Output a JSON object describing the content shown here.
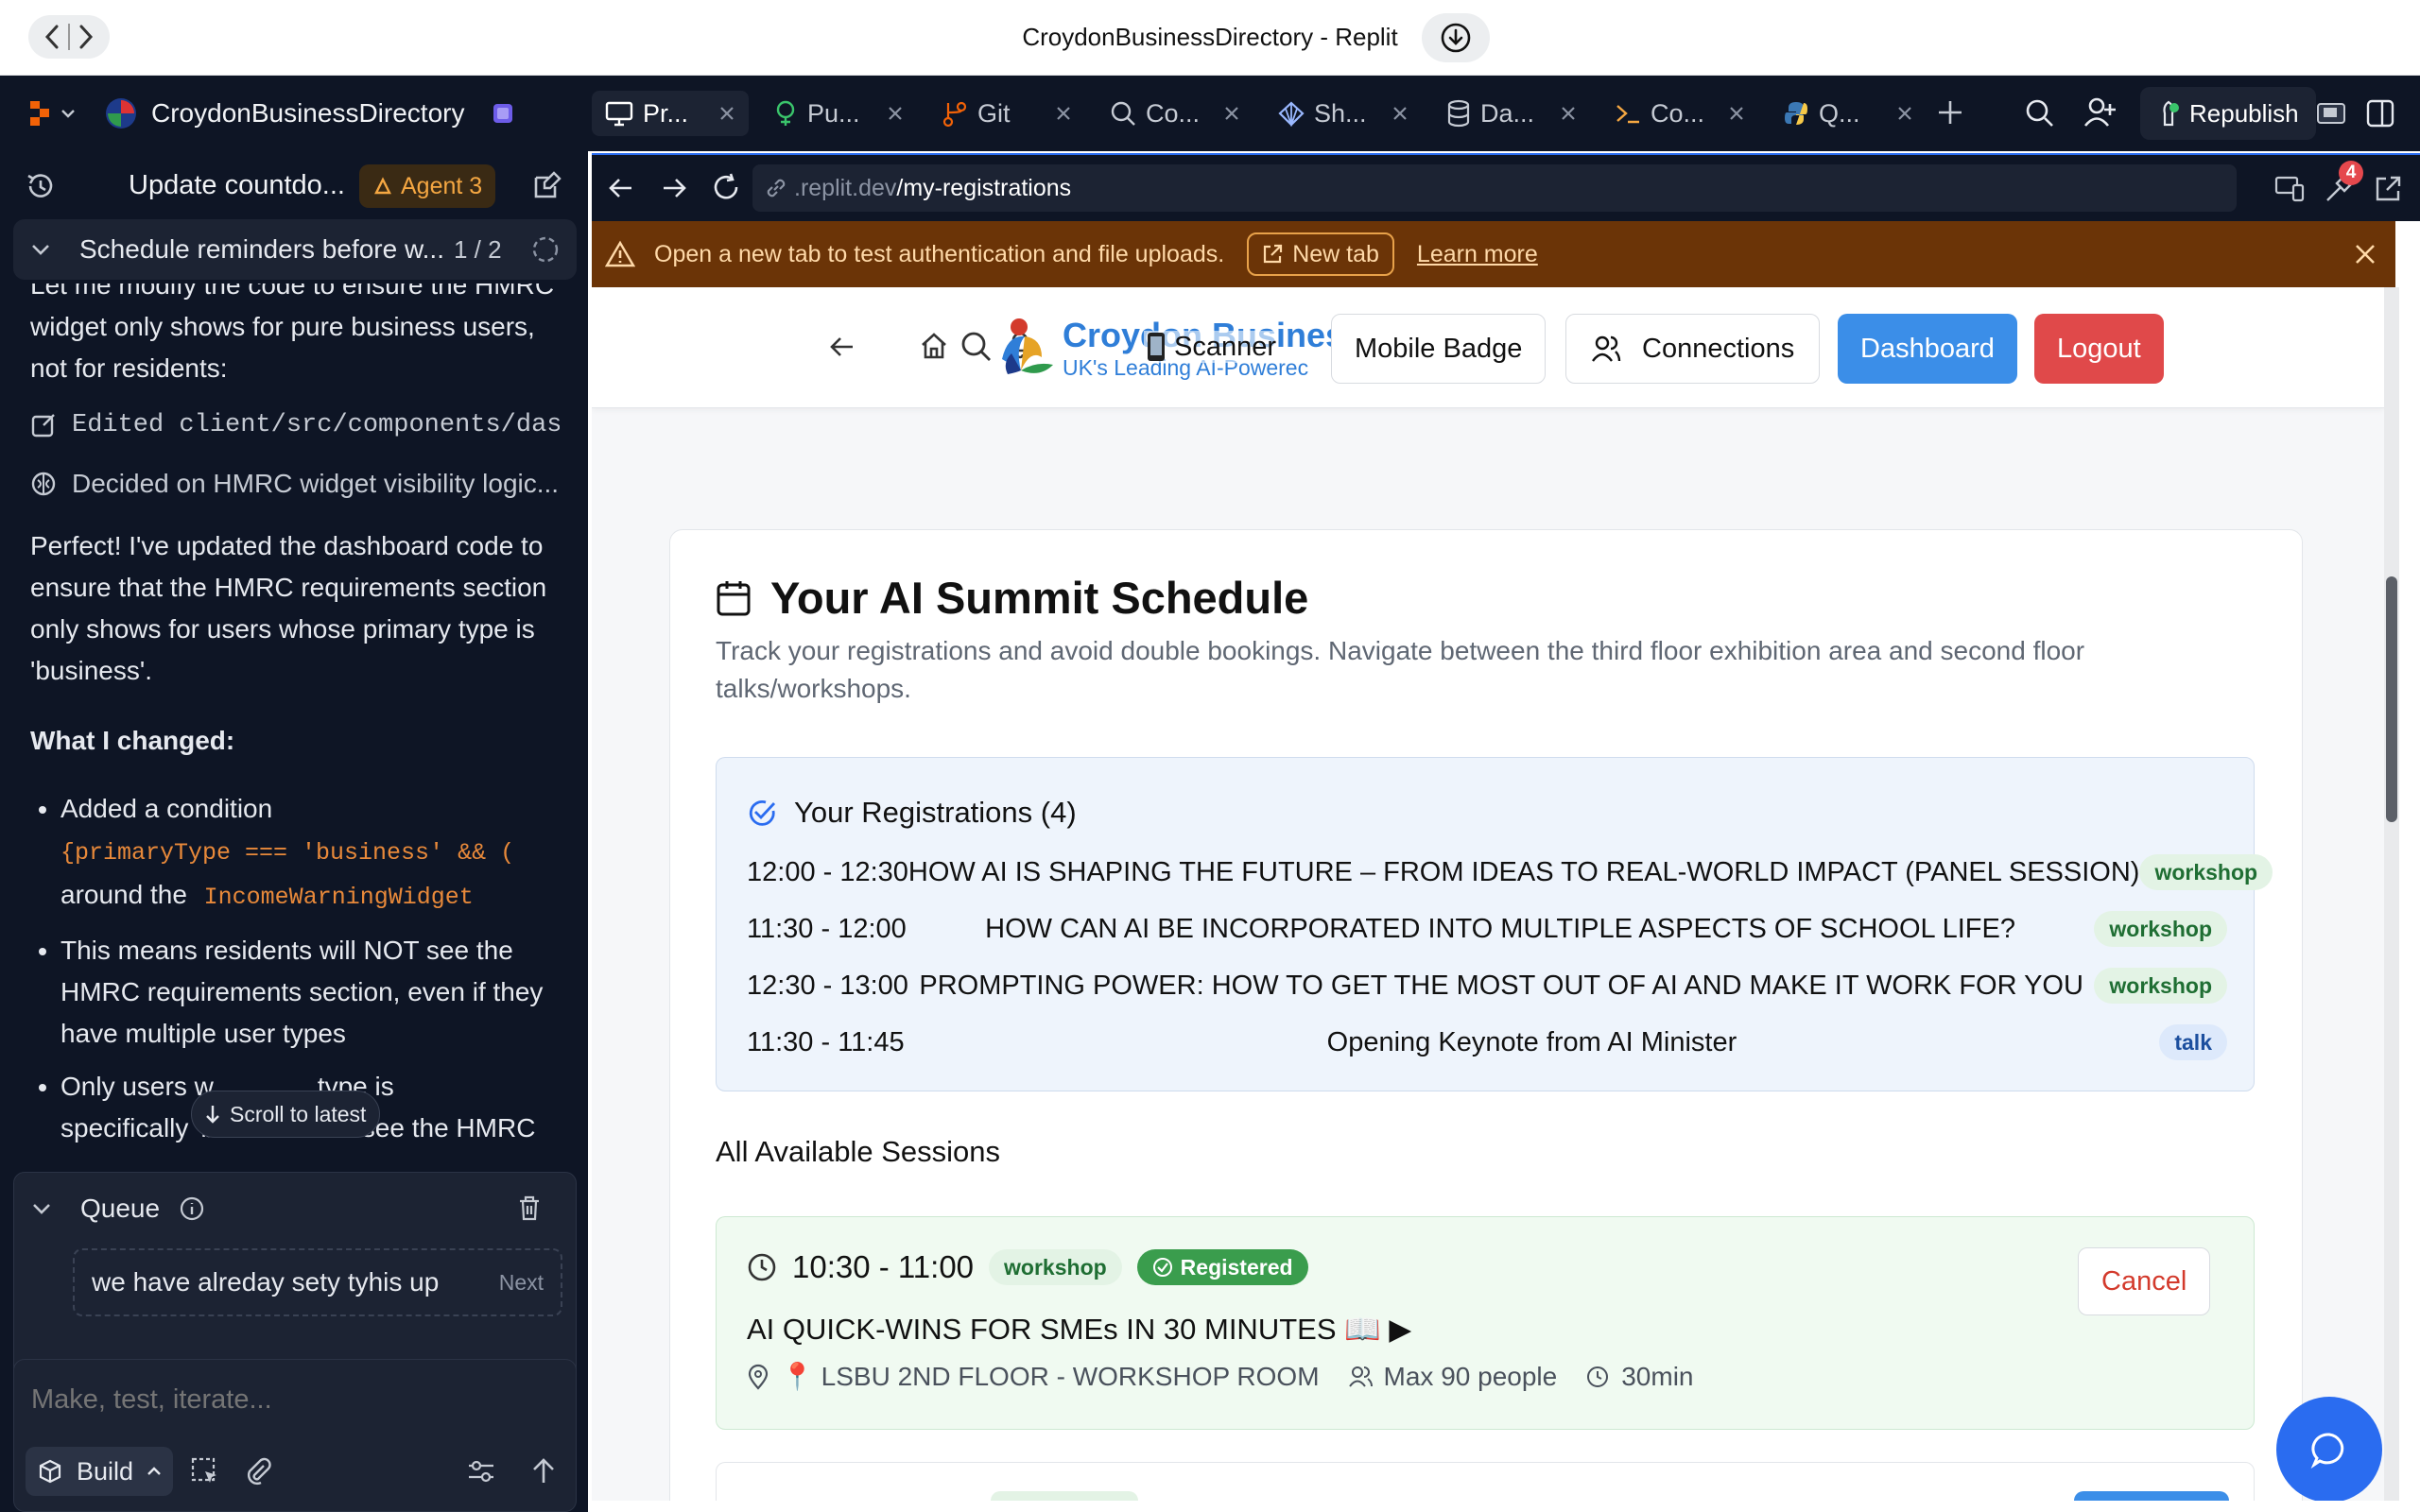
{
  "window": {
    "title": "CroydonBusinessDirectory - Replit"
  },
  "left_panel": {
    "project_name": "CroydonBusinessDirectory",
    "thread_title": "Update countdo...",
    "agent_badge": "Agent 3",
    "task": {
      "title": "Schedule reminders before w...",
      "counter": "1 / 2"
    },
    "chat": {
      "intro": "Let me modify the code to ensure the HMRC widget only shows for pure business users, not for residents:",
      "actions": [
        {
          "icon": "edit-icon",
          "text": "Edited client/src/components/dash..."
        },
        {
          "icon": "brain-icon",
          "text": "Decided on HMRC widget visibility logic..."
        }
      ],
      "summary": "Perfect! I've updated the dashboard code to ensure that the HMRC requirements section only shows for users whose primary type is 'business'.",
      "changes_heading": "What I changed:",
      "bullet1_a": "Added a condition",
      "bullet1_code": "{primaryType === 'business' && (",
      "bullet1_b": "around the",
      "bullet1_code2": "IncomeWarningWidget",
      "bullet2": "This means residents will NOT see the HMRC requirements section, even if they have multiple user types",
      "bullet3_a": "Only users w",
      "bullet3_b": "type is",
      "bullet3_c": "specifically 'business' will see the HMRC",
      "scroll_latest": "Scroll to latest"
    },
    "queue": {
      "label": "Queue",
      "item": "we have alreday sety tyhis up",
      "item_action": "Next"
    },
    "composer": {
      "placeholder": "Make, test, iterate...",
      "build_label": "Build"
    }
  },
  "tabs": [
    {
      "label": "Pr...",
      "icon": "monitor-icon",
      "active": true
    },
    {
      "label": "Pu...",
      "icon": "publish-icon"
    },
    {
      "label": "Git",
      "icon": "git-icon"
    },
    {
      "label": "Co...",
      "icon": "search-icon"
    },
    {
      "label": "Sh...",
      "icon": "shell-icon"
    },
    {
      "label": "Da...",
      "icon": "database-icon"
    },
    {
      "label": "Co...",
      "icon": "console-icon"
    },
    {
      "label": "Q...",
      "icon": "python-icon"
    }
  ],
  "toolbar": {
    "republish": "Republish",
    "notification_count": "4"
  },
  "address": {
    "domain": ".replit.dev",
    "path": "/my-registrations"
  },
  "banner": {
    "message": "Open a new tab to test authentication and file uploads.",
    "new_tab": "New tab",
    "learn_more": "Learn more"
  },
  "app": {
    "brand": "Croydon Busines",
    "tagline": "UK's Leading AI-Powerec",
    "nav": {
      "scanner": "Scanner",
      "mobile_badge": "Mobile Badge",
      "connections": "Connections",
      "dashboard": "Dashboard",
      "logout": "Logout"
    },
    "schedule": {
      "title": "Your AI Summit Schedule",
      "description": "Track your registrations and avoid double bookings. Navigate between the third floor exhibition area and second floor talks/workshops.",
      "registrations_title": "Your Registrations (4)",
      "registrations": [
        {
          "time": "12:00 - 12:30",
          "title": "HOW AI IS SHAPING THE FUTURE – FROM IDEAS TO REAL-WORLD IMPACT (PANEL SESSION)",
          "type": "workshop"
        },
        {
          "time": "11:30 - 12:00",
          "title": "HOW CAN AI BE INCORPORATED INTO MULTIPLE ASPECTS OF SCHOOL LIFE?",
          "type": "workshop"
        },
        {
          "time": "12:30 - 13:00",
          "title": "PROMPTING POWER: HOW TO GET THE MOST OUT OF AI AND MAKE IT WORK FOR YOU",
          "type": "workshop"
        },
        {
          "time": "11:30 - 11:45",
          "title": "Opening Keynote from AI Minister",
          "type": "talk"
        }
      ],
      "available_title": "All Available Sessions",
      "session": {
        "time": "10:30 - 11:00",
        "type": "workshop",
        "status": "Registered",
        "title": "AI QUICK-WINS FOR SMEs IN 30 MINUTES 📖 ▶",
        "location": "📍 LSBU 2ND FLOOR - WORKSHOP ROOM",
        "capacity": "Max 90 people",
        "duration": "30min",
        "cancel": "Cancel"
      }
    }
  },
  "colors": {
    "accent": "#2a6cf0",
    "dashboard": "#3b8ee8",
    "logout": "#e0494a",
    "registered": "#3a9d4d",
    "banner_bg": "#6b3407",
    "panel_bg": "#0e1525"
  }
}
